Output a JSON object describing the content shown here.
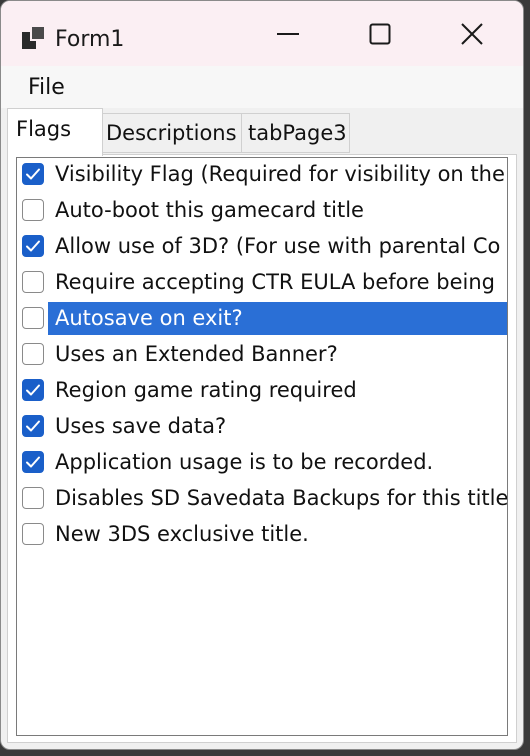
{
  "window": {
    "title": "Form1",
    "icon": "app-window-icon"
  },
  "caption": {
    "minimize_icon": "minimize-icon",
    "maximize_icon": "maximize-icon",
    "close_icon": "close-icon"
  },
  "menu": {
    "file": "File"
  },
  "tabs": {
    "flags": "Flags",
    "descriptions": "Descriptions",
    "page3": "tabPage3"
  },
  "colors": {
    "selection": "#2a6fd6",
    "checkbox_checked": "#1a5fc9"
  },
  "flags": [
    {
      "label": "Visibility Flag (Required for visibility on the",
      "checked": true,
      "selected": false
    },
    {
      "label": "Auto-boot this gamecard title",
      "checked": false,
      "selected": false
    },
    {
      "label": "Allow use of 3D? (For use with parental Co",
      "checked": true,
      "selected": false
    },
    {
      "label": "Require accepting CTR EULA before being",
      "checked": false,
      "selected": false
    },
    {
      "label": "Autosave on exit?",
      "checked": false,
      "selected": true
    },
    {
      "label": "Uses an Extended Banner?",
      "checked": false,
      "selected": false
    },
    {
      "label": "Region game rating required",
      "checked": true,
      "selected": false
    },
    {
      "label": "Uses save data?",
      "checked": true,
      "selected": false
    },
    {
      "label": "Application usage is to be recorded.",
      "checked": true,
      "selected": false
    },
    {
      "label": "Disables SD Savedata Backups for this title",
      "checked": false,
      "selected": false
    },
    {
      "label": "New 3DS exclusive title.",
      "checked": false,
      "selected": false
    }
  ]
}
